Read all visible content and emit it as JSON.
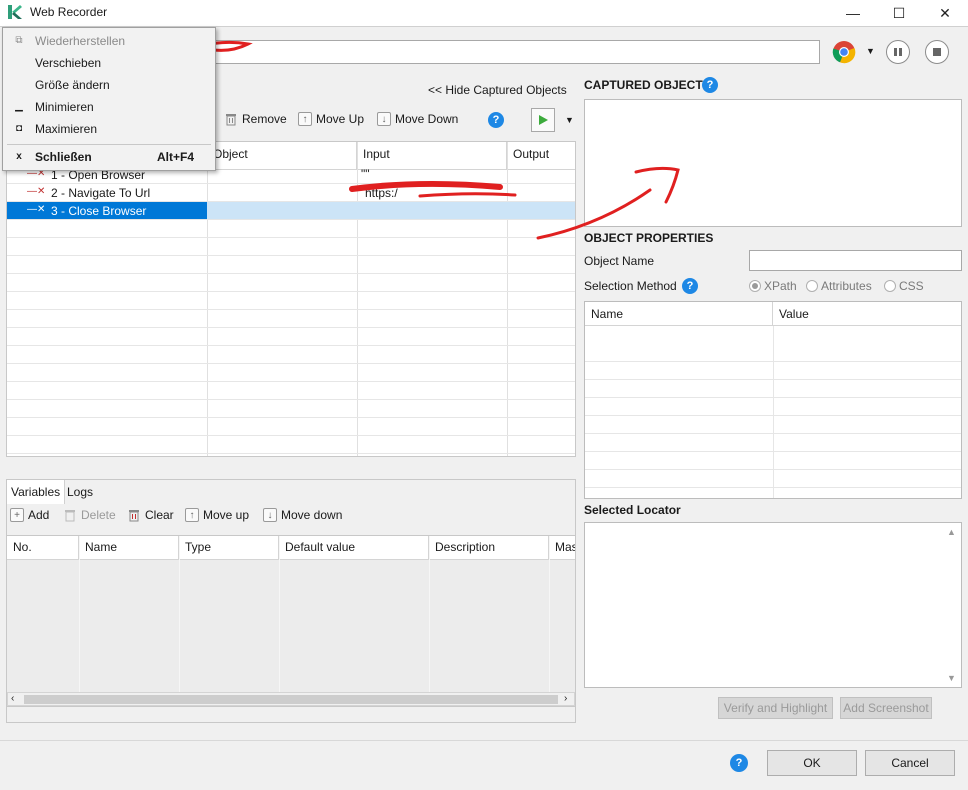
{
  "window": {
    "title": "Web Recorder",
    "minimize_glyph": "—",
    "maximize_glyph": "☐",
    "close_glyph": "✕"
  },
  "toolbar": {
    "hide_captured": "<< Hide Captured Objects",
    "remove": "Remove",
    "move_up": "Move Up",
    "move_down": "Move Down"
  },
  "steps_table": {
    "columns": [
      "Object",
      "Input",
      "Output"
    ],
    "rows": [
      {
        "label": "1 - Open Browser",
        "input": "\"\""
      },
      {
        "label": "2 - Navigate To Url",
        "input": "https:/"
      },
      {
        "label": "3 - Close Browser",
        "input": ""
      }
    ]
  },
  "bottom_tabs": [
    "Variables",
    "Logs"
  ],
  "vars_toolbar": {
    "add": "Add",
    "delete": "Delete",
    "clear": "Clear",
    "move_up": "Move up",
    "move_down": "Move down"
  },
  "vars_table": {
    "columns": [
      "No.",
      "Name",
      "Type",
      "Default value",
      "Description",
      "Mas"
    ]
  },
  "right_panel": {
    "captured_title": "CAPTURED OBJECTS",
    "props_title": "OBJECT PROPERTIES",
    "object_name_label": "Object Name",
    "selection_method_label": "Selection Method",
    "radios": [
      "XPath",
      "Attributes",
      "CSS"
    ],
    "props_columns": [
      "Name",
      "Value"
    ],
    "selected_locator": "Selected Locator",
    "verify_btn": "Verify and Highlight",
    "screenshot_btn": "Add Screenshot"
  },
  "footer": {
    "ok": "OK",
    "cancel": "Cancel"
  },
  "context_menu": {
    "items": [
      {
        "icon": "⧉",
        "label": "Wiederherstellen",
        "disabled": true
      },
      {
        "icon": "",
        "label": "Verschieben"
      },
      {
        "icon": "",
        "label": "Größe ändern"
      },
      {
        "icon": "▁",
        "label": "Minimieren"
      },
      {
        "icon": "◘",
        "label": "Maximieren"
      }
    ],
    "close": {
      "icon": "x",
      "label": "Schließen",
      "shortcut": "Alt+F4"
    }
  },
  "colors": {
    "selection": "#0078d7",
    "help": "#1e88e5",
    "annotation": "#e02020",
    "run": "#3cab3c"
  }
}
